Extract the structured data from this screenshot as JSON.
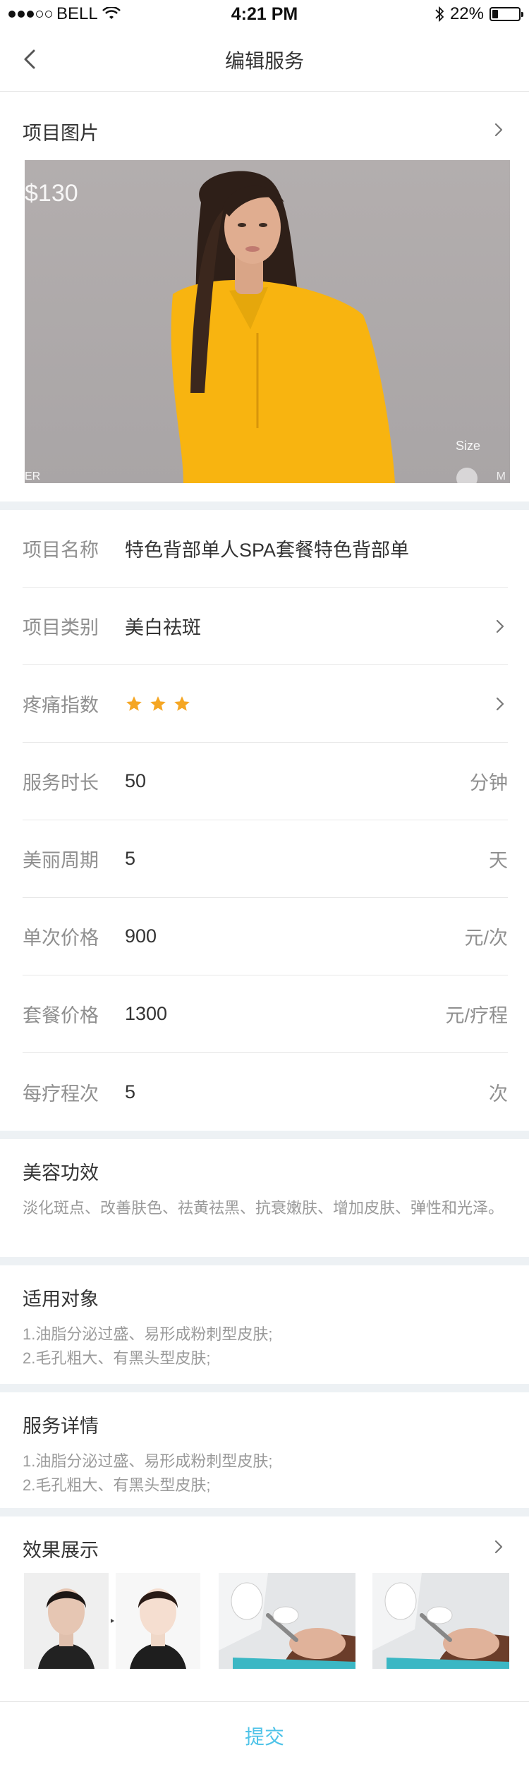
{
  "status_bar": {
    "carrier": "BELL",
    "time": "4:21 PM",
    "battery": "22%",
    "battery_level": 0.22
  },
  "nav": {
    "title": "编辑服务"
  },
  "image_section": {
    "title": "项目图片",
    "price_text": "$130",
    "size_text": "Size",
    "corner_text_left": "ER",
    "corner_text_right": "M"
  },
  "form": {
    "name": {
      "label": "项目名称",
      "value": "特色背部单人SPA套餐特色背部单"
    },
    "category": {
      "label": "项目类别",
      "value": "美白祛斑"
    },
    "pain": {
      "label": "疼痛指数",
      "rating": 3
    },
    "duration": {
      "label": "服务时长",
      "value": "50",
      "unit": "分钟"
    },
    "cycle": {
      "label": "美丽周期",
      "value": "5",
      "unit": "天"
    },
    "single_price": {
      "label": "单次价格",
      "value": "900",
      "unit": "元/次"
    },
    "package_price": {
      "label": "套餐价格",
      "value": "1300",
      "unit": "元/疗程"
    },
    "sessions": {
      "label": "每疗程次",
      "value": "5",
      "unit": "次"
    }
  },
  "effects_text": {
    "title": "美容功效",
    "body": "淡化斑点、改善肤色、祛黄祛黑、抗衰嫩肤、增加皮肤、弹性和光泽。"
  },
  "target": {
    "title": "适用对象",
    "line1": "1.油脂分泌过盛、易形成粉刺型皮肤;",
    "line2": "2.毛孔粗大、有黑头型皮肤;"
  },
  "details": {
    "title": "服务详情",
    "line1": "1.油脂分泌过盛、易形成粉刺型皮肤;",
    "line2": "2.毛孔粗大、有黑头型皮肤;"
  },
  "gallery": {
    "title": "效果展示"
  },
  "submit": {
    "label": "提交"
  },
  "colors": {
    "accent": "#4fc3e8",
    "star": "#f5a623",
    "divider": "#edf1f4",
    "dress": "#f8b410"
  }
}
